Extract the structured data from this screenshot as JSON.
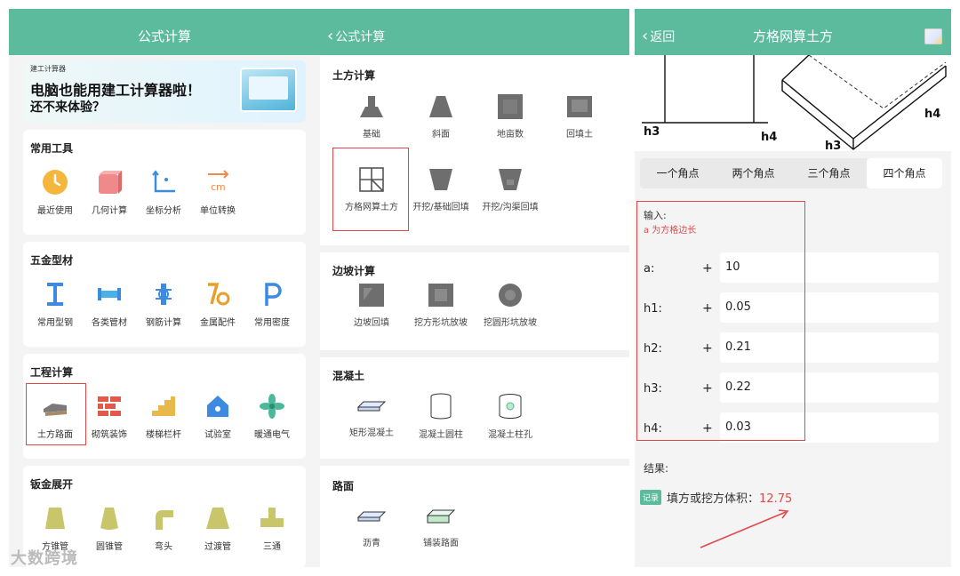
{
  "screen1": {
    "title": "公式计算",
    "banner": {
      "small": "建工计算器",
      "line1": "电脑也能用建工计算器啦！",
      "line2": "还不来体验？"
    },
    "sections": [
      {
        "title": "常用工具",
        "items": [
          "最近使用",
          "几何计算",
          "坐标分析",
          "单位转换"
        ]
      },
      {
        "title": "五金型材",
        "items": [
          "常用型钢",
          "各类管材",
          "钢筋计算",
          "金属配件",
          "常用密度"
        ]
      },
      {
        "title": "工程计算",
        "items": [
          "土方路面",
          "砌筑装饰",
          "楼梯栏杆",
          "试验室",
          "暖通电气"
        ]
      },
      {
        "title": "钣金展开",
        "items": [
          "方锥管",
          "圆锥管",
          "弯头",
          "过渡管",
          "三通"
        ]
      }
    ],
    "highlighted_item": "土方路面"
  },
  "screen2": {
    "back_label": "公式计算",
    "sections": [
      {
        "title": "土方计算",
        "items": [
          "基础",
          "斜面",
          "地亩数",
          "回填土",
          "方格网算土方",
          "开挖/基础回填",
          "开挖/沟渠回填"
        ]
      },
      {
        "title": "边坡计算",
        "items": [
          "边坡回填",
          "挖方形坑放坡",
          "挖圆形坑放坡"
        ]
      },
      {
        "title": "混凝土",
        "items": [
          "矩形混凝土",
          "混凝土圆柱",
          "混凝土柱孔"
        ]
      },
      {
        "title": "路面",
        "items": [
          "沥青",
          "铺装路面"
        ]
      }
    ],
    "highlighted_item": "方格网算土方"
  },
  "screen3": {
    "back_label": "返回",
    "title": "方格网算土方",
    "diagram_labels": [
      "h3",
      "h4",
      "h4",
      "h3"
    ],
    "tabs": [
      "一个角点",
      "两个角点",
      "三个角点",
      "四个角点"
    ],
    "active_tab": "四个角点",
    "input_header": "输入:",
    "input_hint": "a 为方格边长",
    "fields": [
      {
        "key": "a:",
        "value": "10"
      },
      {
        "key": "h1:",
        "value": "0.05"
      },
      {
        "key": "h2:",
        "value": "0.21"
      },
      {
        "key": "h3:",
        "value": "0.22"
      },
      {
        "key": "h4:",
        "value": "0.03"
      }
    ],
    "result_label": "结果:",
    "result_badge": "记录",
    "result_text": "填方或挖方体积：",
    "result_value": "12.75"
  },
  "watermark": "大数跨境",
  "colors": {
    "header": "#5dbb9d",
    "highlight": "#e2484a"
  }
}
